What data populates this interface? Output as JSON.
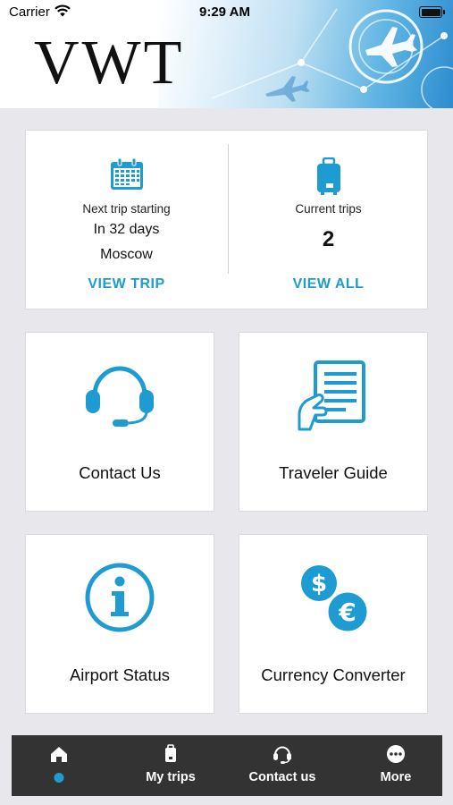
{
  "status_bar": {
    "carrier": "Carrier",
    "time": "9:29 AM"
  },
  "header": {
    "logo": "VWT"
  },
  "trip_summary": {
    "next_trip": {
      "label": "Next trip starting",
      "when": "In 32 days",
      "destination": "Moscow",
      "action": "VIEW TRIP"
    },
    "current_trips": {
      "label": "Current trips",
      "count": "2",
      "action": "VIEW ALL"
    }
  },
  "tiles": [
    {
      "label": "Contact Us",
      "icon": "headset-icon"
    },
    {
      "label": "Traveler Guide",
      "icon": "guide-document-icon"
    },
    {
      "label": "Airport Status",
      "icon": "info-icon"
    },
    {
      "label": "Currency Converter",
      "icon": "currency-icon"
    }
  ],
  "tab_bar": {
    "tabs": [
      {
        "label": "",
        "icon": "home-icon",
        "selected": true
      },
      {
        "label": "My trips",
        "icon": "luggage-icon"
      },
      {
        "label": "Contact us",
        "icon": "headset-icon"
      },
      {
        "label": "More",
        "icon": "more-icon"
      }
    ]
  },
  "colors": {
    "accent": "#1e9bd0",
    "tab_bar": "#333333",
    "background": "#e8e8ec"
  }
}
